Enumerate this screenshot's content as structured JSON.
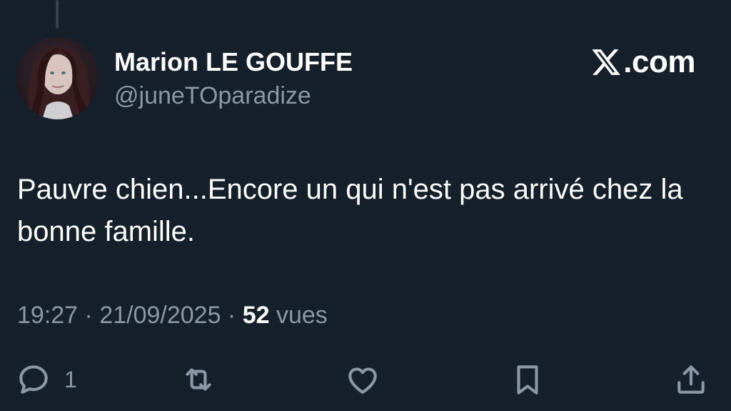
{
  "author": {
    "display_name": "Marion LE GOUFFE",
    "handle": "@juneTOparadize",
    "avatar": "profile-photo"
  },
  "brand": {
    "text": ".com",
    "icon": "x-logo-icon"
  },
  "tweet": {
    "text": "Pauvre chien...Encore un qui n'est pas arrivé chez la bonne famille."
  },
  "meta": {
    "time": "19:27",
    "separator": " · ",
    "date": "21/09/2025",
    "views_count": "52",
    "views_label": " vues"
  },
  "actions": {
    "reply_count": "1",
    "icons": [
      "reply-icon",
      "retweet-icon",
      "like-icon",
      "bookmark-icon",
      "share-icon"
    ]
  },
  "colors": {
    "background": "#15202b",
    "text_primary": "#ffffff",
    "text_secondary": "#8b98a5",
    "icon": "#8b98a5"
  }
}
